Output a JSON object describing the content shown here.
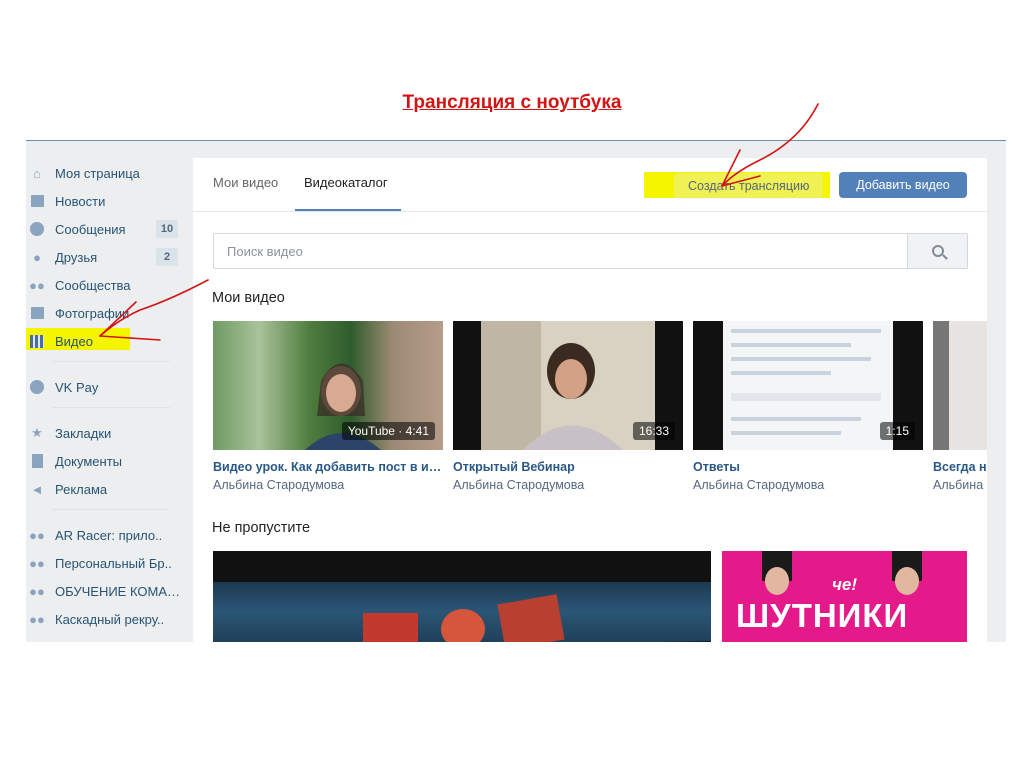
{
  "slide": {
    "title": "Трансляция с ноутбука"
  },
  "sidebar": {
    "items": [
      {
        "label": "Моя страница",
        "icon": "home-icon"
      },
      {
        "label": "Новости",
        "icon": "news-icon"
      },
      {
        "label": "Сообщения",
        "icon": "messages-icon",
        "count": "10"
      },
      {
        "label": "Друзья",
        "icon": "friends-icon",
        "count": "2"
      },
      {
        "label": "Сообщества",
        "icon": "communities-icon"
      },
      {
        "label": "Фотографии",
        "icon": "camera-icon"
      },
      {
        "label": "Видео",
        "icon": "video-icon",
        "highlighted": true
      }
    ],
    "pay": {
      "label": "VK Pay",
      "icon": "vk-pay-icon"
    },
    "extra": [
      {
        "label": "Закладки",
        "icon": "star-icon"
      },
      {
        "label": "Документы",
        "icon": "document-icon"
      },
      {
        "label": "Реклама",
        "icon": "megaphone-icon"
      }
    ],
    "groups": [
      {
        "label": "AR Racer: прило..",
        "icon": "group-icon"
      },
      {
        "label": "Персональный Бр..",
        "icon": "group-icon"
      },
      {
        "label": "ОБУЧЕНИЕ КОМАН...",
        "icon": "group-icon"
      },
      {
        "label": "Каскадный рекру..",
        "icon": "group-icon"
      }
    ]
  },
  "tabs": {
    "my_videos": "Мои видео",
    "catalog": "Видеокаталог"
  },
  "buttons": {
    "create_stream": "Создать трансляцию",
    "add_video": "Добавить видео"
  },
  "search": {
    "placeholder": "Поиск видео"
  },
  "sections": {
    "my_videos": "Мои видео",
    "dont_miss": "Не пропустите"
  },
  "videos": [
    {
      "title": "Видео урок. Как добавить пост в инстаграм",
      "author": "Альбина Стародумова",
      "duration": "YouTube · 4:41"
    },
    {
      "title": "Открытый Вебинар",
      "author": "Альбина Стародумова",
      "duration": "16:33"
    },
    {
      "title": "Ответы",
      "author": "Альбина Стародумова",
      "duration": "1:15"
    },
    {
      "title": "Всегда на связи",
      "author": "Альбина Стародумова",
      "duration": ""
    }
  ],
  "promos": [
    {
      "title": "ШУТНИКИ",
      "subtitle": "че!"
    }
  ],
  "colors": {
    "accent": "#5181b8",
    "highlight": "#f5f500",
    "annotation": "#d31414"
  }
}
